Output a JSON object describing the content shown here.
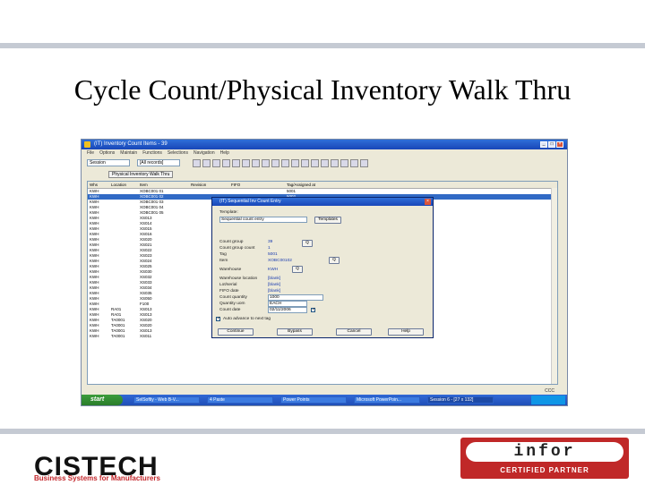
{
  "slide": {
    "title": "Cycle Count/Physical Inventory Walk Thru"
  },
  "window": {
    "title": "(IT) Inventory Count Items - 39",
    "menu": [
      "File",
      "Options",
      "Maintain",
      "Functions",
      "Selections",
      "Navigation",
      "Help"
    ],
    "combo_left": "Session",
    "combo_right": "[All records]",
    "tab_label": "Physical Inventory Walk Thru"
  },
  "grid": {
    "columns": [
      "Whs",
      "Location",
      "Item",
      "Revision",
      "FIFO",
      "Tag/Assigned at"
    ],
    "rows": [
      {
        "whs": "KWH",
        "loc": "",
        "item": "XOBC001 01",
        "rev": "",
        "fifo": "",
        "tag": "5001"
      },
      {
        "whs": "KWH",
        "loc": "",
        "item": "XOBC001 02",
        "rev": "",
        "fifo": "",
        "tag": "5002",
        "selected": true
      },
      {
        "whs": "KWH",
        "loc": "",
        "item": "XOBC001 03",
        "rev": "",
        "fifo": "",
        "tag": ""
      },
      {
        "whs": "KWH",
        "loc": "",
        "item": "XOBC001 04",
        "rev": "",
        "fifo": "",
        "tag": ""
      },
      {
        "whs": "KWH",
        "loc": "",
        "item": "XOBC001 05",
        "rev": "",
        "fifo": "",
        "tag": ""
      },
      {
        "whs": "KWH",
        "loc": "",
        "item": "XS013",
        "rev": "",
        "fifo": "",
        "tag": ""
      },
      {
        "whs": "KWH",
        "loc": "",
        "item": "XS014",
        "rev": "",
        "fifo": "",
        "tag": ""
      },
      {
        "whs": "KWH",
        "loc": "",
        "item": "XS015",
        "rev": "",
        "fifo": "",
        "tag": ""
      },
      {
        "whs": "KWH",
        "loc": "",
        "item": "XS016",
        "rev": "",
        "fifo": "",
        "tag": ""
      },
      {
        "whs": "KWH",
        "loc": "",
        "item": "XS020",
        "rev": "",
        "fifo": "",
        "tag": ""
      },
      {
        "whs": "KWH",
        "loc": "",
        "item": "XS021",
        "rev": "",
        "fifo": "",
        "tag": ""
      },
      {
        "whs": "KWH",
        "loc": "",
        "item": "XS022",
        "rev": "",
        "fifo": "",
        "tag": ""
      },
      {
        "whs": "KWH",
        "loc": "",
        "item": "XS023",
        "rev": "",
        "fifo": "",
        "tag": ""
      },
      {
        "whs": "KWH",
        "loc": "",
        "item": "XS024",
        "rev": "",
        "fifo": "",
        "tag": ""
      },
      {
        "whs": "KWH",
        "loc": "",
        "item": "XS025",
        "rev": "",
        "fifo": "",
        "tag": ""
      },
      {
        "whs": "KWH",
        "loc": "",
        "item": "XS030",
        "rev": "",
        "fifo": "",
        "tag": ""
      },
      {
        "whs": "KWH",
        "loc": "",
        "item": "XS032",
        "rev": "",
        "fifo": "",
        "tag": ""
      },
      {
        "whs": "KWH",
        "loc": "",
        "item": "XS033",
        "rev": "",
        "fifo": "",
        "tag": ""
      },
      {
        "whs": "KWH",
        "loc": "",
        "item": "XS034",
        "rev": "",
        "fifo": "",
        "tag": ""
      },
      {
        "whs": "KWH",
        "loc": "",
        "item": "XS035",
        "rev": "",
        "fifo": "",
        "tag": ""
      },
      {
        "whs": "KWH",
        "loc": "",
        "item": "XS050",
        "rev": "",
        "fifo": "",
        "tag": ""
      },
      {
        "whs": "KWH",
        "loc": "",
        "item": "F100",
        "rev": "",
        "fifo": "",
        "tag": ""
      },
      {
        "whs": "KWH",
        "loc": "RA01",
        "item": "XS013",
        "rev": "",
        "fifo": "",
        "tag": ""
      },
      {
        "whs": "KWH",
        "loc": "RA01",
        "item": "XS013",
        "rev": "",
        "fifo": "",
        "tag": ""
      },
      {
        "whs": "KWH",
        "loc": "TA0001",
        "item": "XS020",
        "rev": "",
        "fifo": "12345678",
        "tag": ""
      },
      {
        "whs": "KWH",
        "loc": "TA0001",
        "item": "XS020",
        "rev": "",
        "fifo": "12345678",
        "tag": ""
      },
      {
        "whs": "KWH",
        "loc": "TA0001",
        "item": "XS013",
        "rev": "",
        "fifo": "12345678",
        "tag": ""
      },
      {
        "whs": "KWH",
        "loc": "TA0001",
        "item": "XS011",
        "rev": "",
        "fifo": "",
        "tag": ""
      }
    ]
  },
  "dialog": {
    "title": "(IT) Sequential Inv Count Entry",
    "template_label": "Template:",
    "template_value": "Sequential count entry",
    "templates_button": "Templates",
    "fields": [
      {
        "label": "Count group",
        "value": "39"
      },
      {
        "label": "Count group count",
        "value": "1"
      },
      {
        "label": "Tag",
        "value": "5001"
      },
      {
        "label": "Item",
        "value": "XOBC00102"
      },
      {
        "label": "Warehouse",
        "value": "KWH"
      },
      {
        "label": "Warehouse location",
        "value": "[blank]"
      },
      {
        "label": "Lot/serial",
        "value": "[blank]"
      },
      {
        "label": "FIFO date",
        "value": "[blank]"
      },
      {
        "label": "Count quantity",
        "value": "1000"
      },
      {
        "label": "Quantity uom",
        "value": "EACH"
      },
      {
        "label": "Count date",
        "value": "02/11/2006"
      }
    ],
    "auto_advance_label": "Auto advance to next tag",
    "buttons": [
      "Continue",
      "Bypass",
      "Cancel",
      "Help"
    ]
  },
  "statusbar": {
    "text": "",
    "right": "CCC"
  },
  "taskbar": {
    "start": "start",
    "tasks": [
      "SelSoftly - Web B-V...",
      "4 Paste",
      "Power Points",
      "Microsoft PowerPoin...",
      "Session 6 - [27 x 132]"
    ],
    "clock": ""
  },
  "logos": {
    "cistech": {
      "word": "CISTECH",
      "sub": "Business Systems for Manufacturers"
    },
    "infor": {
      "word": "infor",
      "sub": "CERTIFIED PARTNER"
    }
  }
}
